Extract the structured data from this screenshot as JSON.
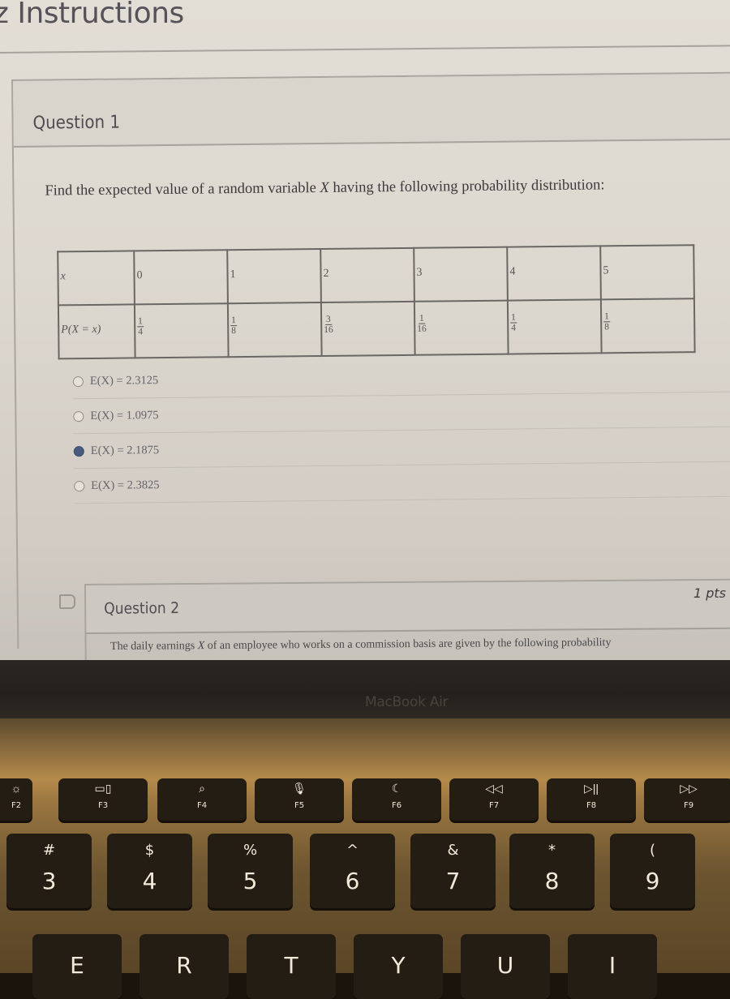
{
  "page": {
    "title": "z Instructions"
  },
  "question1": {
    "title": "Question 1",
    "prompt_before": "Find the expected value of a random variable ",
    "prompt_var": "X",
    "prompt_after": " having the following probability distribution:",
    "table": {
      "row_headers": [
        "x",
        "P(X = x)"
      ],
      "x_values": [
        "0",
        "1",
        "2",
        "3",
        "4",
        "5"
      ],
      "probabilities": [
        {
          "num": "1",
          "den": "4"
        },
        {
          "num": "1",
          "den": "8"
        },
        {
          "num": "3",
          "den": "16"
        },
        {
          "num": "1",
          "den": "16"
        },
        {
          "num": "1",
          "den": "4"
        },
        {
          "num": "1",
          "den": "8"
        }
      ]
    },
    "options": [
      {
        "label": "E(X) = 2.3125",
        "selected": false
      },
      {
        "label": "E(X) = 1.0975",
        "selected": false
      },
      {
        "label": "E(X) = 2.1875",
        "selected": true
      },
      {
        "label": "E(X) = 2.3825",
        "selected": false
      }
    ]
  },
  "question2": {
    "title": "Question 2",
    "points": "1 pts",
    "prompt_before": "The daily earnings ",
    "prompt_var": "X",
    "prompt_after": " of an employee who works on a commission basis are given by the following probability"
  },
  "device": {
    "brand": "MacBook Air",
    "function_keys": [
      {
        "label": "F2",
        "icon": "brightness-up-icon",
        "glyph": "☼"
      },
      {
        "label": "F3",
        "icon": "mission-control-icon",
        "glyph": "▭▯"
      },
      {
        "label": "F4",
        "icon": "search-icon",
        "glyph": "⌕"
      },
      {
        "label": "F5",
        "icon": "microphone-icon",
        "glyph": "🎙"
      },
      {
        "label": "F6",
        "icon": "moon-icon",
        "glyph": "☾"
      },
      {
        "label": "F7",
        "icon": "rewind-icon",
        "glyph": "◁◁"
      },
      {
        "label": "F8",
        "icon": "play-pause-icon",
        "glyph": "▷||"
      },
      {
        "label": "F9",
        "icon": "fast-forward-icon",
        "glyph": "▷▷"
      }
    ],
    "number_keys": [
      {
        "symbol": "#",
        "number": "3"
      },
      {
        "symbol": "$",
        "number": "4"
      },
      {
        "symbol": "%",
        "number": "5"
      },
      {
        "symbol": "^",
        "number": "6"
      },
      {
        "symbol": "&",
        "number": "7"
      },
      {
        "symbol": "*",
        "number": "8"
      },
      {
        "symbol": "(",
        "number": "9"
      }
    ],
    "letter_keys": [
      "E",
      "R",
      "T",
      "Y",
      "U",
      "I"
    ]
  }
}
